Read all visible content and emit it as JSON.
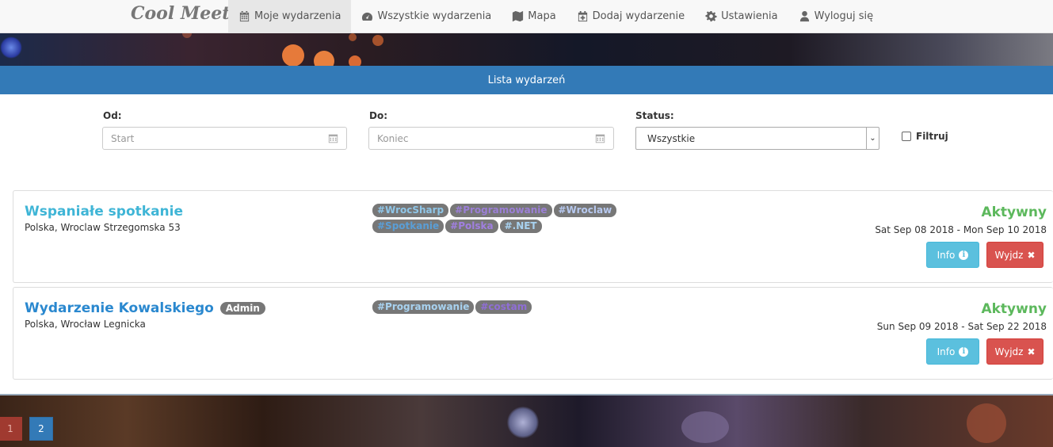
{
  "brand": "Cool Meet",
  "nav": {
    "items": [
      {
        "label": "Moje wydarzenia",
        "icon": "calendar-icon"
      },
      {
        "label": "Wszystkie wydarzenia",
        "icon": "dashboard-icon"
      },
      {
        "label": "Mapa",
        "icon": "map-icon"
      },
      {
        "label": "Dodaj wydarzenie",
        "icon": "calendar-plus-icon"
      },
      {
        "label": "Ustawienia",
        "icon": "gear-icon"
      },
      {
        "label": "Wyloguj się",
        "icon": "user-icon"
      }
    ],
    "active_index": 0
  },
  "list_header": "Lista wydarzeń",
  "filters": {
    "from_label": "Od:",
    "from_placeholder": "Start",
    "to_label": "Do:",
    "to_placeholder": "Koniec",
    "status_label": "Status:",
    "status_value": "Wszystkie",
    "filter_label": "Filtruj",
    "filter_checked": false
  },
  "events": [
    {
      "title": "Wspaniałe spotkanie",
      "location": "Polska, Wroclaw Strzegomska 53",
      "tags": [
        {
          "text": "#WrocSharp",
          "color": "#8fc6e8"
        },
        {
          "text": "#Programowanie",
          "color": "#9b7fd6"
        },
        {
          "text": "#Wroclaw",
          "color": "#b7c9f0"
        },
        {
          "text": "#Spotkanie",
          "color": "#5a9ed6"
        },
        {
          "text": "#Polska",
          "color": "#a07fe0"
        },
        {
          "text": "#.NET",
          "color": "#a8d2f0"
        }
      ],
      "status": "Aktywny",
      "dates": "Sat Sep 08 2018 - Mon Sep 10 2018",
      "info_label": "Info",
      "leave_label": "Wyjdz"
    },
    {
      "title": "Wydarzenie Kowalskiego",
      "badge": "Admin",
      "location": "Polska, Wrocław Legnicka",
      "tags": [
        {
          "text": "#Programowanie",
          "color": "#a8d2f0"
        },
        {
          "text": "#costam",
          "color": "#8f6ed6"
        }
      ],
      "status": "Aktywny",
      "dates": "Sun Sep 09 2018 - Sat Sep 22 2018",
      "info_label": "Info",
      "leave_label": "Wyjdz"
    }
  ],
  "pagination": {
    "pages": [
      "1",
      "2"
    ],
    "current": "2"
  },
  "colors": {
    "primary": "#337ab7",
    "success": "#5cb85c",
    "info": "#5bc0de",
    "danger": "#d9534f"
  }
}
